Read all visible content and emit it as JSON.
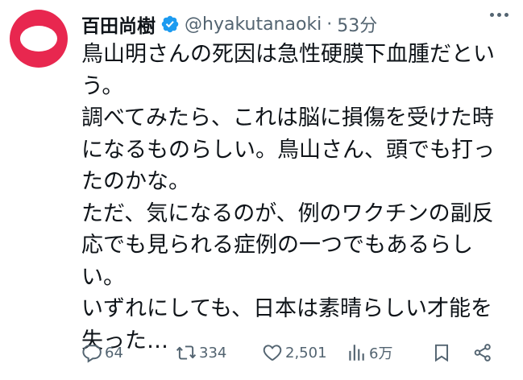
{
  "tweet": {
    "display_name": "百田尚樹",
    "handle": "@hyakutanaoki",
    "separator": "·",
    "time": "53分",
    "body_lines": [
      "鳥山明さんの死因は急性硬膜下血腫だとい",
      "う。",
      "調べてみたら、これは脳に損傷を受けた時",
      "になるものらしい。鳥山さん、頭でも打っ",
      "たのかな。",
      "ただ、気になるのが、例のワクチンの副反",
      "応でも見られる症例の一つでもあるらし",
      "い。",
      "いずれにしても、日本は素晴らしい才能を",
      "失った…"
    ]
  },
  "actions": {
    "replies": "64",
    "retweets": "334",
    "likes": "2,501",
    "views": "6万"
  },
  "colors": {
    "avatar": "#e8274f",
    "verified": "#1d9bf0",
    "text": "#0f1419",
    "muted": "#536471"
  },
  "icons": [
    "verified-badge-icon",
    "more-icon",
    "reply-icon",
    "retweet-icon",
    "like-icon",
    "views-icon",
    "bookmark-icon",
    "share-icon"
  ]
}
